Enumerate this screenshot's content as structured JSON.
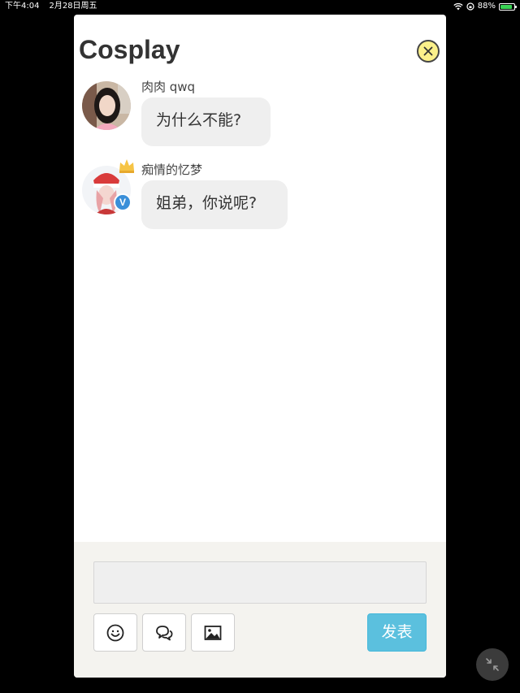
{
  "status_bar": {
    "time": "下午4:04",
    "date": "2月28日周五",
    "battery_percent": "88%",
    "battery_level": 0.88
  },
  "dialog": {
    "title": "Cosplay",
    "close_icon": "close-icon"
  },
  "messages": [
    {
      "username": "肉肉 qwq",
      "text": "为什么不能?",
      "avatar": "user-avatar-photo",
      "verified": false,
      "crown": false
    },
    {
      "username": "痴情的忆梦",
      "text": "姐弟，你说呢?",
      "avatar": "user-avatar-photo",
      "verified": true,
      "verified_label": "V",
      "crown": true
    }
  ],
  "composer": {
    "input_value": "",
    "tools": [
      "emoji-icon",
      "chat-bubbles-icon",
      "image-icon"
    ],
    "send_label": "发表",
    "send_color": "#5bc0de"
  },
  "floating": {
    "collapse_icon": "collapse-arrows-icon"
  }
}
